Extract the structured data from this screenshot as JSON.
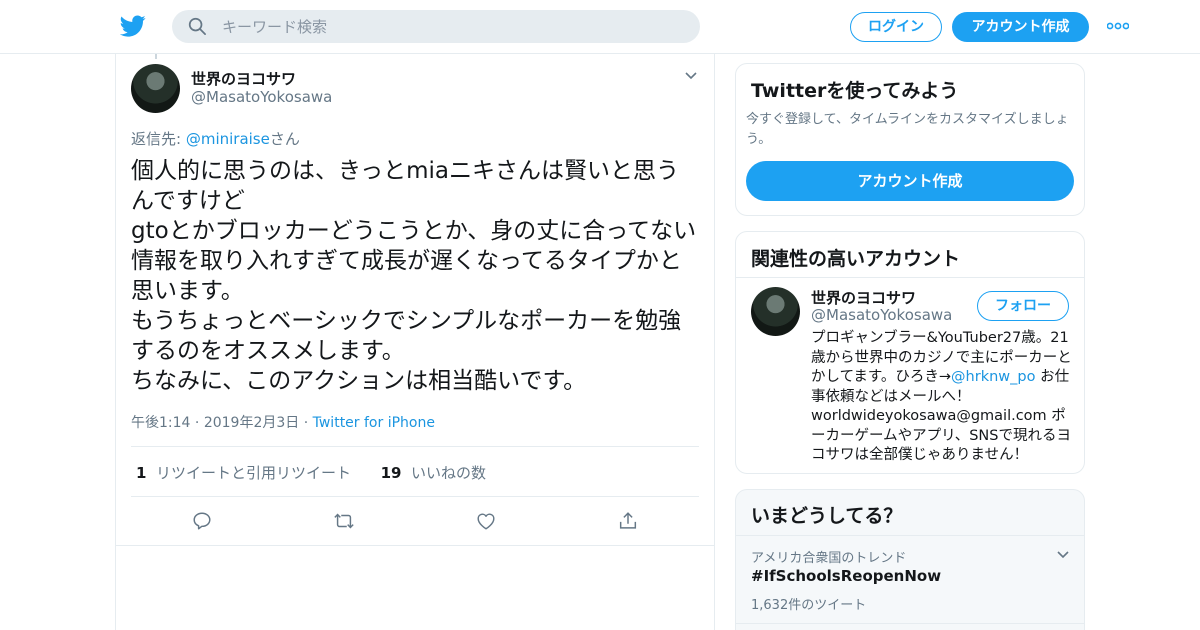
{
  "header": {
    "search_placeholder": "キーワード検索",
    "login_label": "ログイン",
    "signup_label": "アカウント作成"
  },
  "tweet": {
    "author_name": "世界のヨコサワ",
    "author_handle": "@MasatoYokosawa",
    "reply_prefix": "返信先: ",
    "reply_mention": "@miniraise",
    "reply_suffix": "さん",
    "text": "個人的に思うのは、きっとmiaニキさんは賢いと思うんですけど\ngtoとかブロッカーどうこうとか、身の丈に合ってない情報を取り入れすぎて成長が遅くなってるタイプかと思います。\nもうちょっとベーシックでシンプルなポーカーを勉強するのをオススメします。\nちなみに、このアクションは相当酷いです。",
    "time": "午後1:14",
    "date": "2019年2月3日",
    "source": "Twitter for iPhone",
    "retweet_count": "1",
    "retweet_label": "リツイートと引用リツイート",
    "like_count": "19",
    "like_label": "いいねの数",
    "icons": [
      "reply-icon",
      "retweet-icon",
      "like-icon",
      "share-icon"
    ]
  },
  "signup_card": {
    "title": "Twitterを使ってみよう",
    "description": "今すぐ登録して、タイムラインをカスタマイズしましょう。",
    "button_label": "アカウント作成"
  },
  "related_card": {
    "title": "関連性の高いアカウント",
    "name": "世界のヨコサワ",
    "handle": "@MasatoYokosawa",
    "follow_label": "フォロー",
    "bio_part1": "プロギャンブラー&YouTuber27歳。21歳から世界中のカジノで主にポーカーとかしてます。ひろき→",
    "bio_link": "@hrknw_po",
    "bio_part2": " お仕事依頼などはメールへ！ worldwideyokosawa@gmail.com ポーカーゲームやアプリ、SNSで現れるヨコサワは全部僕じゃありません！"
  },
  "trends_card": {
    "title": "いまどうしてる？",
    "context": "アメリカ合衆国のトレンド",
    "trend": "#IfSchoolsReopenNow",
    "count": "1,632件のツイート"
  },
  "colors": {
    "brand": "#1da1f2",
    "link": "#1b95e0",
    "secondary_text": "#657786",
    "border": "#e6ecf0"
  }
}
